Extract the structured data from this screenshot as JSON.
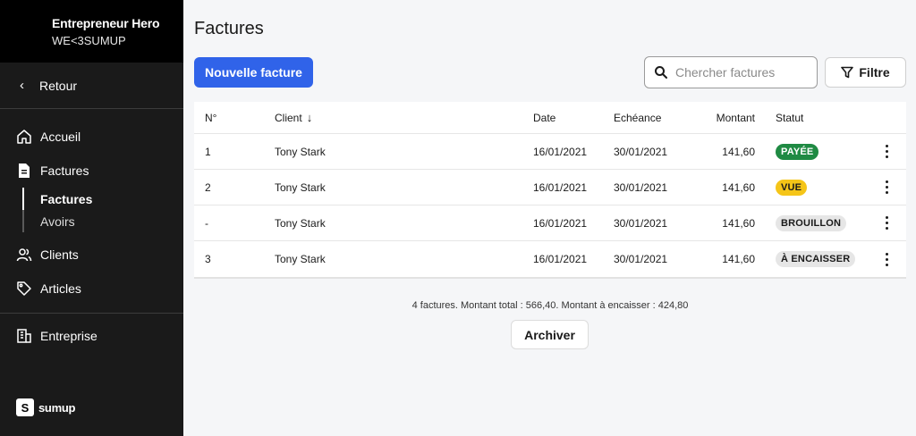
{
  "sidebar": {
    "company": "Entrepreneur Hero",
    "subtitle": "WE<3SUMUP",
    "back_label": "Retour",
    "items": [
      {
        "label": "Accueil",
        "icon": "home-icon"
      },
      {
        "label": "Factures",
        "icon": "document-icon"
      },
      {
        "label": "Clients",
        "icon": "users-icon"
      },
      {
        "label": "Articles",
        "icon": "tag-icon"
      }
    ],
    "sub_items": [
      {
        "label": "Factures",
        "active": true
      },
      {
        "label": "Avoirs",
        "active": false
      }
    ],
    "business_label": "Entreprise",
    "logo_text": "sumup"
  },
  "main": {
    "title": "Factures",
    "new_button": "Nouvelle facture",
    "search_placeholder": "Chercher factures",
    "filter_button": "Filtre",
    "archive_button": "Archiver",
    "summary": "4 factures. Montant total : 566,40. Montant à encaisser : 424,80"
  },
  "table": {
    "headers": {
      "num": "N°",
      "client": "Client",
      "date": "Date",
      "due": "Echéance",
      "amount": "Montant",
      "status": "Statut"
    },
    "sort_indicator": "↓",
    "rows": [
      {
        "num": "1",
        "client": "Tony Stark",
        "date": "16/01/2021",
        "due": "30/01/2021",
        "amount": "141,60",
        "status": "PAYÉE"
      },
      {
        "num": "2",
        "client": "Tony Stark",
        "date": "16/01/2021",
        "due": "30/01/2021",
        "amount": "141,60",
        "status": "VUE"
      },
      {
        "num": "-",
        "client": "Tony Stark",
        "date": "16/01/2021",
        "due": "30/01/2021",
        "amount": "141,60",
        "status": "BROUILLON"
      },
      {
        "num": "3",
        "client": "Tony Stark",
        "date": "16/01/2021",
        "due": "30/01/2021",
        "amount": "141,60",
        "status": "À ENCAISSER"
      }
    ]
  },
  "colors": {
    "primary": "#3063e9",
    "sidebar_bg": "#1a1a1a",
    "sidebar_header_bg": "#000000",
    "status_paid_bg": "#1f8a43",
    "status_paid_fg": "#ffffff",
    "status_seen_bg": "#f5c518",
    "status_seen_fg": "#1a1a1a",
    "status_draft_bg": "#e6e6e6",
    "status_draft_fg": "#1a1a1a",
    "status_due_bg": "#e6e6e6",
    "status_due_fg": "#1a1a1a"
  }
}
